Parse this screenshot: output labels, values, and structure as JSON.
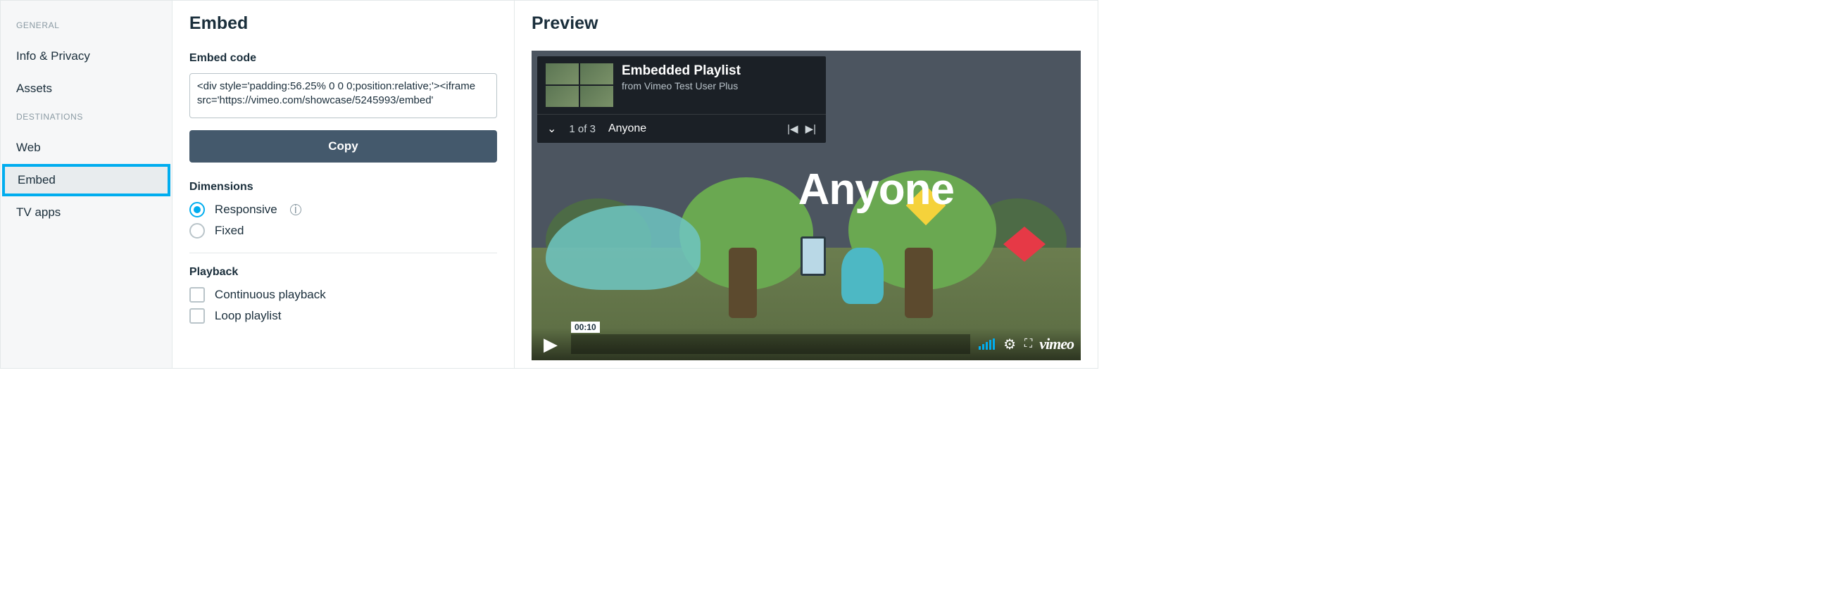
{
  "sidebar": {
    "headings": {
      "general": "GENERAL",
      "destinations": "DESTINATIONS"
    },
    "items": {
      "info_privacy": "Info & Privacy",
      "assets": "Assets",
      "web": "Web",
      "embed": "Embed",
      "tv_apps": "TV apps"
    }
  },
  "settings": {
    "title": "Embed",
    "embed_code_label": "Embed code",
    "embed_code_value": "<div style='padding:56.25% 0 0 0;position:relative;'><iframe\nsrc='https://vimeo.com/showcase/5245993/embed'",
    "copy_label": "Copy",
    "dimensions_label": "Dimensions",
    "dimensions": {
      "responsive": "Responsive",
      "fixed": "Fixed",
      "selected": "responsive"
    },
    "playback_label": "Playback",
    "playback": {
      "continuous": "Continuous playback",
      "loop": "Loop playlist"
    }
  },
  "preview": {
    "title": "Preview",
    "playlist": {
      "title": "Embedded Playlist",
      "subtitle": "from Vimeo Test User Plus",
      "position": "1 of 3",
      "current_track": "Anyone"
    },
    "video": {
      "overlay_title": "Anyone",
      "time": "00:10"
    },
    "brand": "vimeo"
  }
}
